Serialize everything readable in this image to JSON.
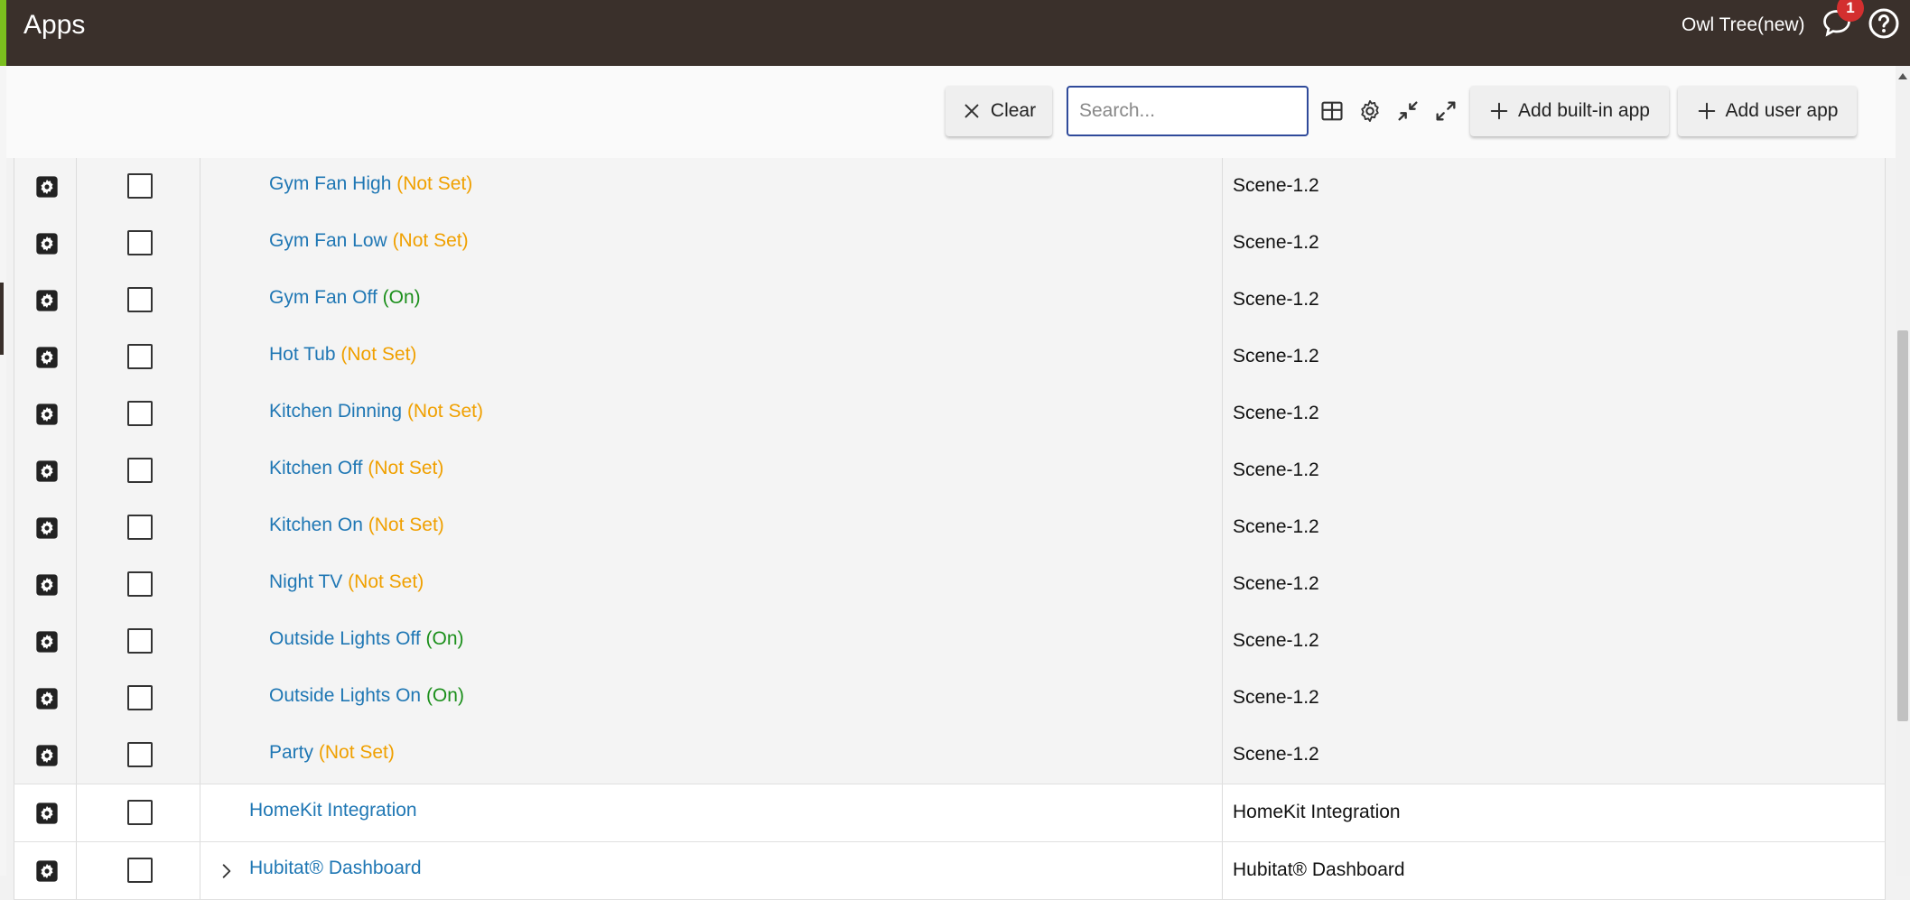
{
  "header": {
    "title": "Apps",
    "hub_name": "Owl Tree(new)",
    "notification_count": "1"
  },
  "toolbar": {
    "clear_label": "Clear",
    "search_placeholder": "Search...",
    "add_builtin_label": "Add built-in app",
    "add_user_label": "Add user app"
  },
  "rows": [
    {
      "name": "Gym Fan High",
      "status": "(Not Set)",
      "status_kind": "notset",
      "type": "Scene-1.2"
    },
    {
      "name": "Gym Fan Low",
      "status": "(Not Set)",
      "status_kind": "notset",
      "type": "Scene-1.2"
    },
    {
      "name": "Gym Fan Off",
      "status": "(On)",
      "status_kind": "on",
      "type": "Scene-1.2"
    },
    {
      "name": "Hot Tub",
      "status": "(Not Set)",
      "status_kind": "notset",
      "type": "Scene-1.2"
    },
    {
      "name": "Kitchen Dinning",
      "status": "(Not Set)",
      "status_kind": "notset",
      "type": "Scene-1.2"
    },
    {
      "name": "Kitchen Off",
      "status": "(Not Set)",
      "status_kind": "notset",
      "type": "Scene-1.2"
    },
    {
      "name": "Kitchen On",
      "status": "(Not Set)",
      "status_kind": "notset",
      "type": "Scene-1.2"
    },
    {
      "name": "Night TV",
      "status": "(Not Set)",
      "status_kind": "notset",
      "type": "Scene-1.2"
    },
    {
      "name": "Outside Lights Off",
      "status": "(On)",
      "status_kind": "on",
      "type": "Scene-1.2"
    },
    {
      "name": "Outside Lights On",
      "status": "(On)",
      "status_kind": "on",
      "type": "Scene-1.2"
    },
    {
      "name": "Party",
      "status": "(Not Set)",
      "status_kind": "notset",
      "type": "Scene-1.2"
    }
  ],
  "parent_rows": [
    {
      "name": "HomeKit Integration",
      "type": "HomeKit Integration",
      "expandable": false
    },
    {
      "name": "Hubitat® Dashboard",
      "type": "Hubitat® Dashboard",
      "expandable": true
    }
  ],
  "colors": {
    "header_bg": "#3a302b",
    "accent": "#7bbf1e",
    "link": "#1f77b4",
    "status_not_set": "#f0a000",
    "status_on": "#1b8f1b",
    "badge": "#d32f2f"
  }
}
